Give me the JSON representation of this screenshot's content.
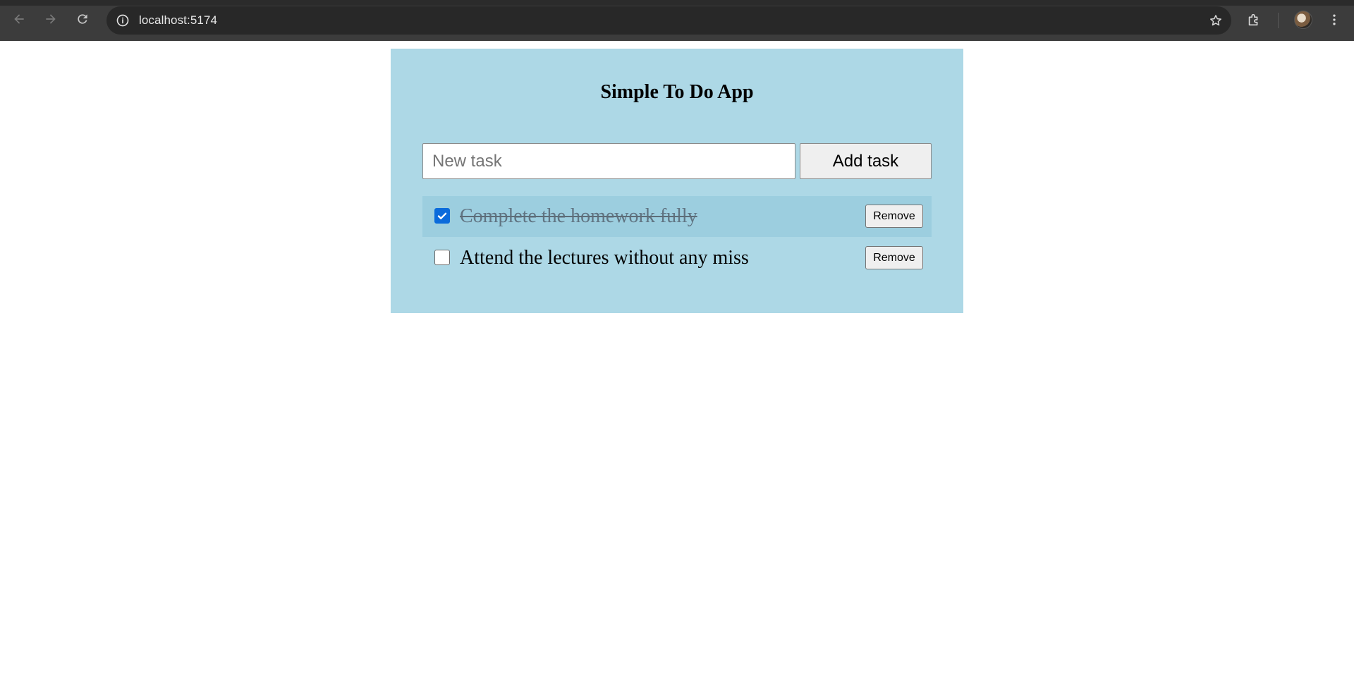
{
  "browser": {
    "url": "localhost:5174",
    "icons": {
      "back": "arrow-left-icon",
      "forward": "arrow-right-icon",
      "reload": "reload-icon",
      "site_info": "info-icon",
      "bookmark": "star-icon",
      "extensions": "puzzle-icon",
      "profile": "avatar",
      "menu": "kebab-menu-icon"
    }
  },
  "app": {
    "title": "Simple To Do App",
    "background_color": "#add8e6",
    "input": {
      "value": "",
      "placeholder": "New task"
    },
    "add_button_label": "Add task",
    "tasks": [
      {
        "text": "Complete the homework fully",
        "completed": true,
        "remove_label": "Remove"
      },
      {
        "text": "Attend the lectures without any miss",
        "completed": false,
        "remove_label": "Remove"
      }
    ]
  }
}
